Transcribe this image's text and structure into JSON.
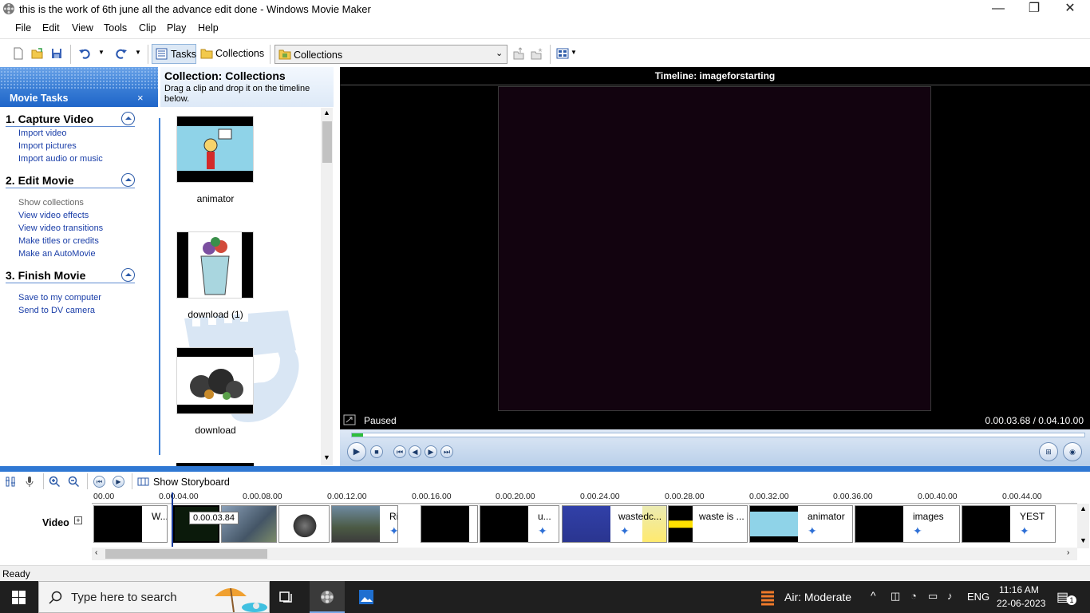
{
  "window": {
    "title": "this is the work  of 6th june all the advance edit done - Windows Movie Maker",
    "minimize": "—",
    "restore": "❐",
    "close": "✕"
  },
  "menu": [
    "File",
    "Edit",
    "View",
    "Tools",
    "Clip",
    "Play",
    "Help"
  ],
  "toolbar": {
    "tasks_label": "Tasks",
    "collections_label": "Collections",
    "dropdown_value": "Collections"
  },
  "tasks_pane": {
    "header": "Movie Tasks",
    "close": "×",
    "sections": [
      {
        "title": "1. Capture Video",
        "links": [
          "Import video",
          "Import pictures",
          "Import audio or music"
        ]
      },
      {
        "title": "2. Edit Movie",
        "links": [
          "Show collections",
          "View video effects",
          "View video transitions",
          "Make titles or credits",
          "Make an AutoMovie"
        ]
      },
      {
        "title": "3. Finish Movie",
        "links": [
          "Save to my computer",
          "Send to DV camera"
        ]
      }
    ]
  },
  "collection": {
    "title": "Collection: Collections",
    "subtitle": "Drag a clip and drop it on the timeline below.",
    "items": [
      "animator",
      "download (1)",
      "download"
    ]
  },
  "monitor": {
    "title": "Timeline: imageforstarting",
    "status": "Paused",
    "timecode": "0.00.03.68 / 0.04.10.00",
    "progress_fraction": 0.015
  },
  "timeline_toolbar": {
    "storyboard_label": "Show Storyboard"
  },
  "timeline": {
    "ruler": [
      "00.00",
      "0.00.04.00",
      "0.00.08.00",
      "0.00.12.00",
      "0.00.16.00",
      "0.00.20.00",
      "0.00.24.00",
      "0.00.28.00",
      "0.00.32.00",
      "0.00.36.00",
      "0.00.40.00",
      "0.00.44.00"
    ],
    "track_label": "Video",
    "track_expand": "+",
    "tooltip": "0.00.03.84",
    "clips": [
      "W...",
      "",
      "",
      "",
      "River",
      "",
      "u...",
      "wastedc...",
      "waste is ...",
      "animator",
      "images",
      "YEST"
    ]
  },
  "status_bar": "Ready",
  "taskbar": {
    "search_placeholder": "Type here to search",
    "weather": "Air: Moderate",
    "language": "ENG",
    "time": "11:16 AM",
    "date": "22-06-2023",
    "notification_count": "1"
  }
}
